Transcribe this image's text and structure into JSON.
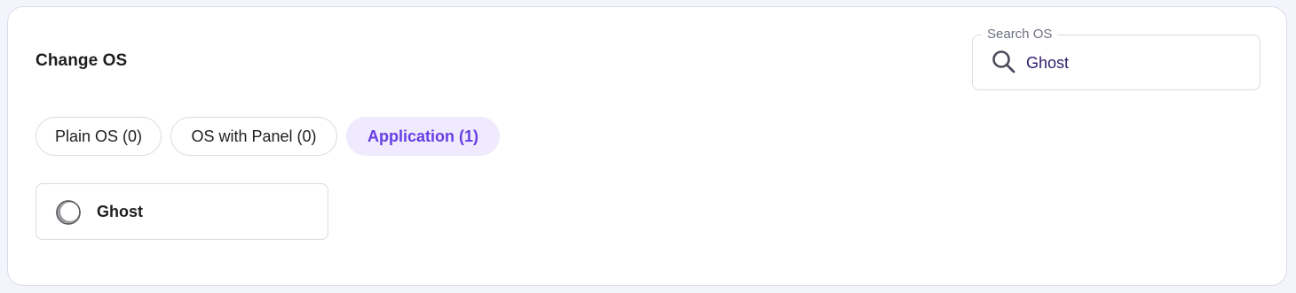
{
  "panel": {
    "title": "Change OS"
  },
  "search": {
    "legend": "Search OS",
    "value": "Ghost",
    "icon": "search-icon"
  },
  "tabs": [
    {
      "label": "Plain OS (0)",
      "active": false
    },
    {
      "label": "OS with Panel (0)",
      "active": false
    },
    {
      "label": "Application (1)",
      "active": true
    }
  ],
  "results": [
    {
      "name": "Ghost",
      "icon": "ghost-logo-icon"
    }
  ],
  "colors": {
    "accent": "#673de6",
    "accent_bg": "#efeafd",
    "border": "#dadce0",
    "page_bg": "#f4f4fd",
    "text": "#1d1e20"
  }
}
